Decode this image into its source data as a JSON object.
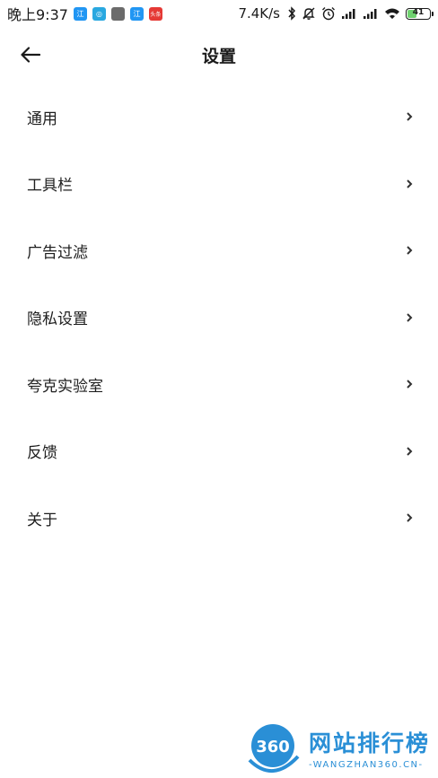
{
  "status_bar": {
    "time": "晚上9:37",
    "notifications": [
      {
        "icon": "app-notification-icon",
        "color": "#2196f3",
        "glyph": "江"
      },
      {
        "icon": "chat-notification-icon",
        "color": "#29a8e0",
        "glyph": "◎"
      },
      {
        "icon": "gray-app-notification-icon",
        "color": "#6b6b6b",
        "glyph": ""
      },
      {
        "icon": "app-notification-icon",
        "color": "#2196f3",
        "glyph": "江"
      },
      {
        "icon": "news-notification-icon",
        "color": "#e53935",
        "glyph": "头条"
      }
    ],
    "network_speed": "7.4K/s",
    "battery_level": "41",
    "battery_fraction": 0.41
  },
  "header": {
    "title": "设置"
  },
  "menu": {
    "items": [
      {
        "label": "通用"
      },
      {
        "label": "工具栏"
      },
      {
        "label": "广告过滤"
      },
      {
        "label": "隐私设置"
      },
      {
        "label": "夸克实验室"
      },
      {
        "label": "反馈"
      },
      {
        "label": "关于"
      }
    ]
  },
  "watermark": {
    "logo_text": "360",
    "title": "网站排行榜",
    "subtitle": "-WANGZHAN360.CN-",
    "color": "#2a8fd6"
  }
}
